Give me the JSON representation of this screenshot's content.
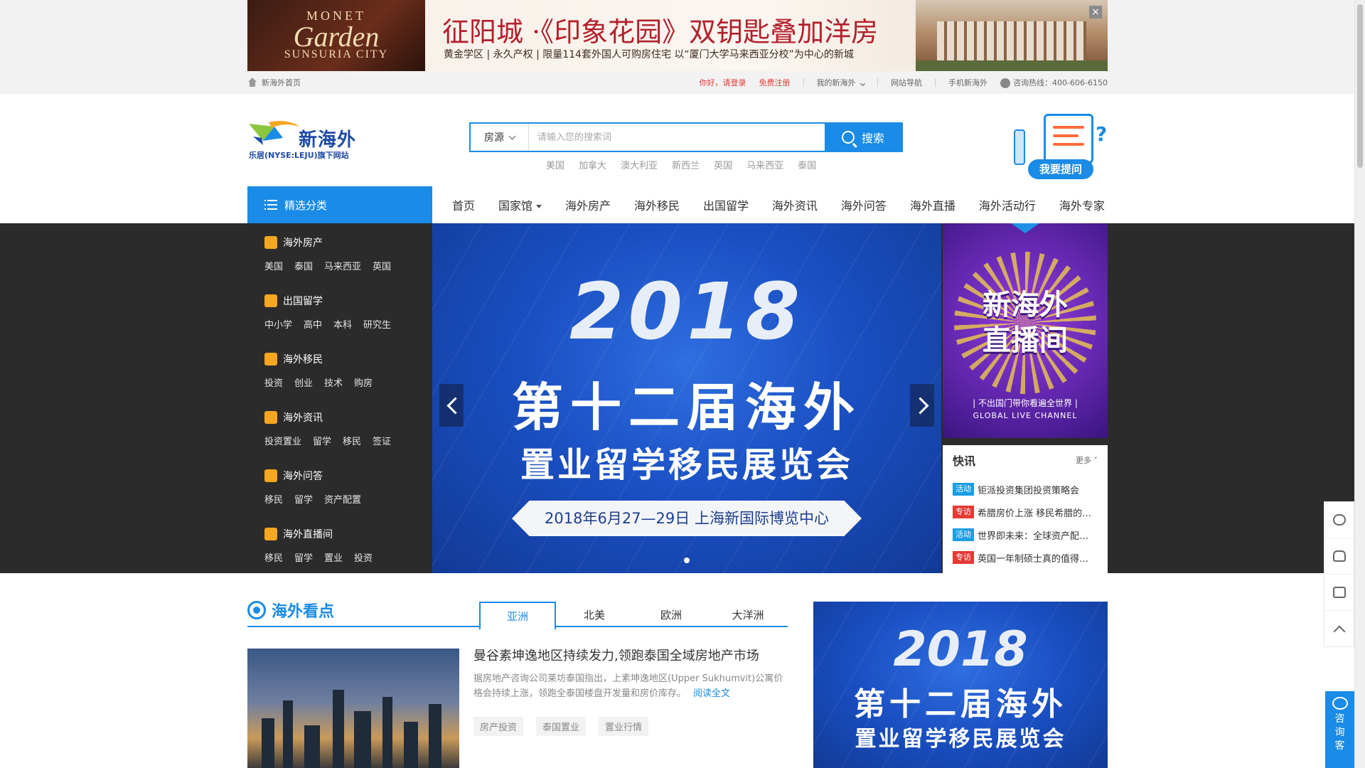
{
  "colors": {
    "brand_blue": "#1a8be6",
    "dark_panel": "#2b2b2b",
    "tag_event": "#1a9ee6",
    "tag_topic": "#e53935"
  },
  "ad": {
    "logo_line1": "MONET",
    "logo_line2": "Garden",
    "logo_line3": "SUNSURIA CITY",
    "title": "征阳城 ·《印象花园》双钥匙叠加洋房",
    "subtitle": "黄金学区 | 永久产权 | 限量114套外国人可购房住宅      以“厦门大学马来西亚分校”为中心的新城",
    "close_label": "×"
  },
  "topbar": {
    "home_label": "新海外首页",
    "greeting": "你好，请登录",
    "register": "免费注册",
    "my_account": "我的新海外",
    "site_nav": "网站导航",
    "mobile": "手机新海外",
    "hotline": "咨询热线：400-606-6150"
  },
  "header": {
    "logo_name": "新海外",
    "logo_tag": "乐居(NYSE:LEJU)旗下网站",
    "search_select": "房源",
    "search_placeholder": "请输入您的搜索词",
    "search_button": "搜索",
    "hot_links": [
      "美国",
      "加拿大",
      "澳大利亚",
      "新西兰",
      "英国",
      "马来西亚",
      "泰国"
    ],
    "ask_button": "我要提问",
    "ask_qmark": "?"
  },
  "nav": {
    "category_label": "精选分类",
    "items": [
      "首页",
      "国家馆",
      "海外房产",
      "海外移民",
      "出国留学",
      "海外资讯",
      "海外问答",
      "海外直播",
      "海外活动行",
      "海外专家"
    ]
  },
  "categories": [
    {
      "title": "海外房产",
      "icon": "building-icon",
      "subs": [
        "美国",
        "泰国",
        "马来西亚",
        "英国"
      ]
    },
    {
      "title": "出国留学",
      "icon": "graduation-cap-icon",
      "subs": [
        "中小学",
        "高中",
        "本科",
        "研究生"
      ]
    },
    {
      "title": "海外移民",
      "icon": "paper-plane-icon",
      "subs": [
        "投资",
        "创业",
        "技术",
        "购房"
      ]
    },
    {
      "title": "海外资讯",
      "icon": "newspaper-icon",
      "subs": [
        "投资置业",
        "留学",
        "移民",
        "签证"
      ]
    },
    {
      "title": "海外问答",
      "icon": "question-bubble-icon",
      "subs": [
        "移民",
        "留学",
        "资产配置"
      ]
    },
    {
      "title": "海外直播间",
      "icon": "live-camera-icon",
      "subs": [
        "移民",
        "留学",
        "置业",
        "投资"
      ]
    }
  ],
  "slider": {
    "year": "2018",
    "line1": "第十二届海外",
    "line2": "置业留学移民展览会",
    "ribbon": "2018年6月27—29日  上海新国际博览中心"
  },
  "live_banner": {
    "line1": "新海外",
    "line2": "直播间",
    "line3": "| 不出国门带你看遍全世界 |",
    "line4": "GLOBAL LIVE CHANNEL"
  },
  "news": {
    "title": "快讯",
    "more": "更多 ˅",
    "items": [
      {
        "tag": "活动",
        "tag_color": "#1a9ee6",
        "text": "钜派投资集团投资策略会"
      },
      {
        "tag": "专访",
        "tag_color": "#e53935",
        "text": "希腊房价上涨 移民希腊的…"
      },
      {
        "tag": "活动",
        "tag_color": "#1a9ee6",
        "text": "世界即未来：全球资产配…"
      },
      {
        "tag": "专访",
        "tag_color": "#e53935",
        "text": "英国一年制硕士真的值得…"
      }
    ]
  },
  "consult": {
    "label": "咨询客"
  },
  "section": {
    "title": "海外看点",
    "tabs": [
      "亚洲",
      "北美",
      "欧洲",
      "大洋洲"
    ],
    "article": {
      "title": "曼谷素坤逸地区持续发力,领跑泰国全域房地产市场",
      "desc": "据房地产咨询公司莱坊泰国指出，上素坤逸地区(Upper Sukhumvit)公寓价格会持续上涨，领跑全泰国楼盘开发量和房价库存。",
      "more": "阅读全文",
      "tags": [
        "房产投资",
        "泰国置业",
        "置业行情"
      ]
    }
  },
  "promo": {
    "year": "2018",
    "line1": "第十二届海外",
    "line2": "置业留学移民展览会"
  }
}
